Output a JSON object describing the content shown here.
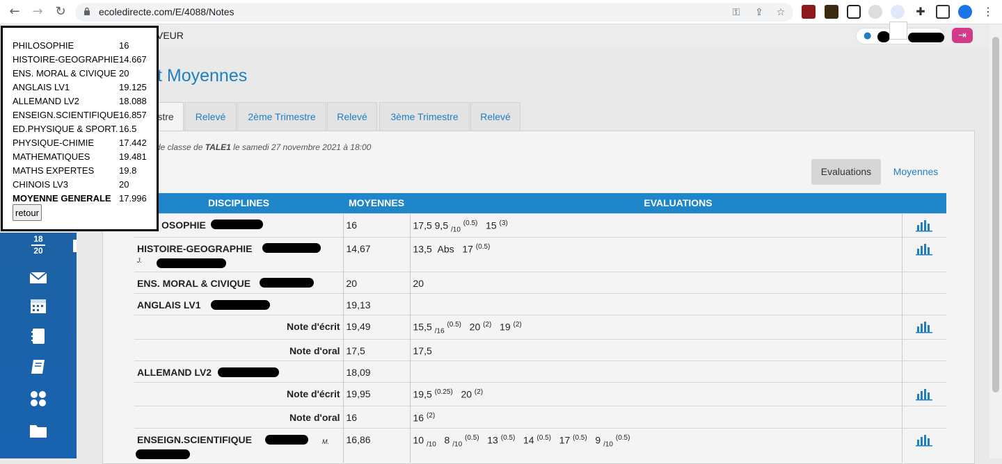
{
  "browser": {
    "url": "ecoledirecte.com/E/4088/Notes"
  },
  "topbar": {
    "menu_text": "VEUR"
  },
  "page_title": "t Moyennes",
  "tabs": [
    {
      "label": "stre",
      "active": true
    },
    {
      "label": "Relevé"
    },
    {
      "label": "2ème Trimestre"
    },
    {
      "label": "Relevé"
    },
    {
      "label": "3ème Trimestre"
    },
    {
      "label": "Relevé"
    }
  ],
  "subtitle": {
    "prefix": "de classe de ",
    "class": "TALE1",
    "suffix": " le samedi 27 novembre 2021  à 18:00"
  },
  "view_buttons": {
    "evaluations": "Evaluations",
    "moyennes": "Moyennes"
  },
  "table": {
    "headers": {
      "disciplines": "DISCIPLINES",
      "moyennes": "MOYENNES",
      "evaluations": "EVALUATIONS"
    },
    "rows": {
      "philo": {
        "name": "OSOPHIE",
        "moy": "16"
      },
      "histgeo": {
        "name": "HISTOIRE-GEOGRAPHIE",
        "teacher": "J.",
        "moy": "14,67",
        "e1": "13,5",
        "e2": "Abs",
        "e3": "17",
        "e3c": "(0.5)"
      },
      "emc": {
        "name": "ENS. MORAL & CIVIQUE",
        "moy": "20",
        "e1": "20"
      },
      "anglais": {
        "name": "ANGLAIS LV1",
        "moy": "19,13"
      },
      "anglais_ecrit": {
        "name": "Note d'écrit",
        "moy": "19,49"
      },
      "anglais_oral": {
        "name": "Note d'oral",
        "moy": "17,5",
        "e1": "17,5"
      },
      "allemand": {
        "name": "ALLEMAND LV2",
        "moy": "18,09"
      },
      "allemand_ecrit": {
        "name": "Note d'écrit",
        "moy": "19,95",
        "e1": "19,5",
        "e1c": "(0.25)",
        "e2": "20",
        "e2c": "(2)"
      },
      "allemand_oral": {
        "name": "Note d'oral",
        "moy": "16",
        "e1": "16",
        "e1c": "(2)"
      },
      "science": {
        "name": "ENSEIGN.SCIENTIFIQUE",
        "teacher": "M.",
        "moy": "16,86"
      }
    },
    "philo_evals": "17,5  9,5",
    "philo_denom": "/10",
    "philo_coef1": "(0.5)",
    "philo_e3": "15",
    "philo_coef3": "(3)",
    "ang_e1": "15,5",
    "ang_d1": "/16",
    "ang_c1": "(0.5)",
    "ang_e2": "20",
    "ang_c2": "(2)",
    "ang_e3": "19",
    "ang_c3": "(2)",
    "sci_e1": "10",
    "sci_d1": "/10",
    "sci_e2": "8",
    "sci_d2": "/10",
    "sci_c2": "(0.5)",
    "sci_e3": "13",
    "sci_c3": "(0.5)",
    "sci_e4": "14",
    "sci_c4": "(0.5)",
    "sci_e5": "17",
    "sci_c5": "(0.5)",
    "sci_e6": "9",
    "sci_d6": "/10",
    "sci_c6": "(0.5)"
  },
  "sidebar": {
    "fraction_top": "18",
    "fraction_bottom": "20"
  },
  "popup": {
    "rows": [
      {
        "subject": "PHILOSOPHIE",
        "value": "16"
      },
      {
        "subject": "HISTOIRE-GEOGRAPHIE",
        "value": "14.667"
      },
      {
        "subject": "ENS. MORAL & CIVIQUE",
        "value": "20"
      },
      {
        "subject": "ANGLAIS LV1",
        "value": "19.125"
      },
      {
        "subject": "ALLEMAND LV2",
        "value": "18.088"
      },
      {
        "subject": "ENSEIGN.SCIENTIFIQUE",
        "value": "16.857"
      },
      {
        "subject": "ED.PHYSIQUE & SPORT.",
        "value": "16.5"
      },
      {
        "subject": "PHYSIQUE-CHIMIE",
        "value": "17.442"
      },
      {
        "subject": "MATHEMATIQUES",
        "value": "19.481"
      },
      {
        "subject": "MATHS EXPERTES",
        "value": "19.8"
      },
      {
        "subject": "CHINOIS LV3",
        "value": "20"
      }
    ],
    "total": {
      "subject": "MOYENNE GENERALE",
      "value": "17.996"
    },
    "retour_label": "retour"
  },
  "colors": {
    "accent": "#1f86c9",
    "link": "#1f7fc1",
    "sidebar": "#1d62a4",
    "logout": "#d23b8a"
  }
}
